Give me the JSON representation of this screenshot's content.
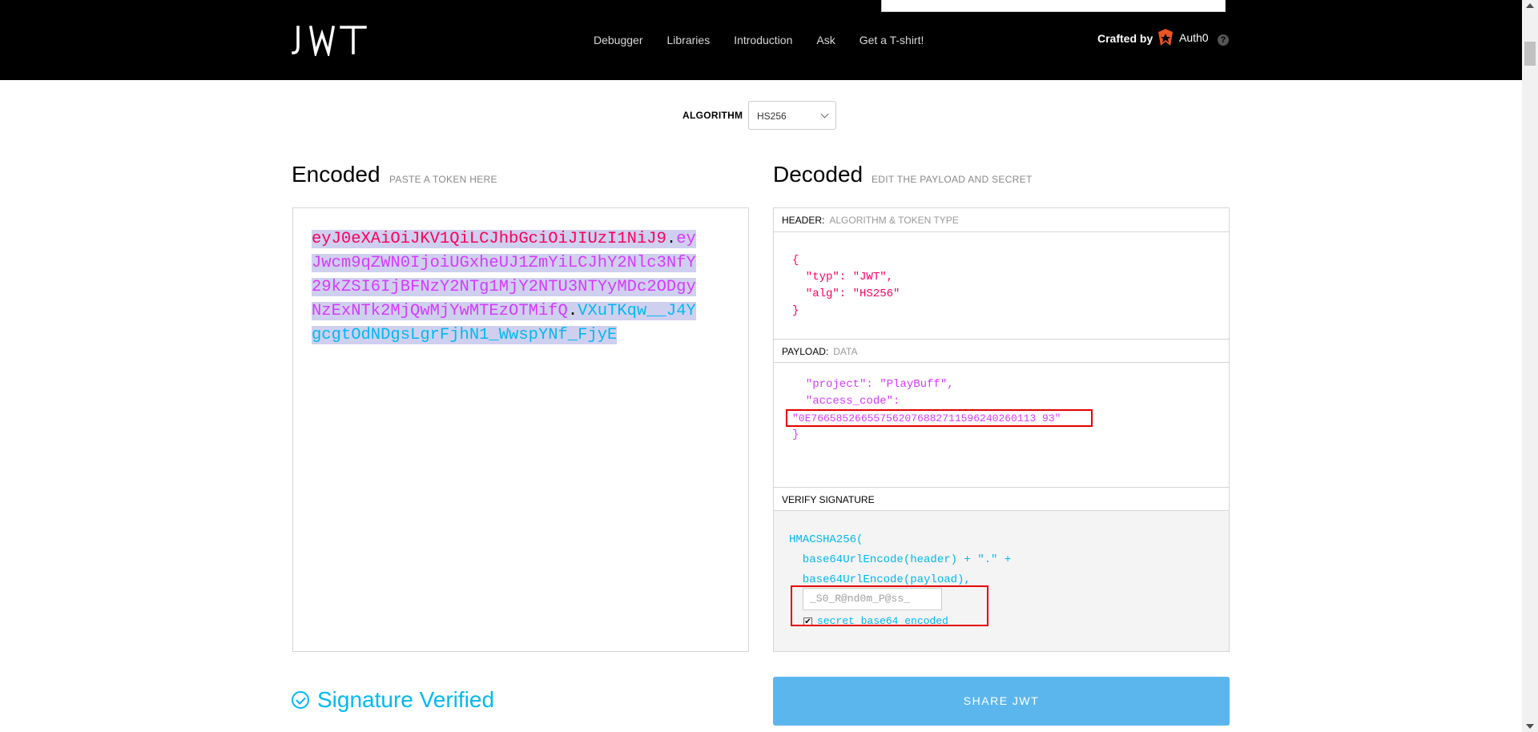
{
  "header": {
    "nav": [
      "Debugger",
      "Libraries",
      "Introduction",
      "Ask",
      "Get a T-shirt!"
    ],
    "crafted_by": "Crafted by",
    "brand": "Auth0",
    "help": "?"
  },
  "algorithm": {
    "label": "ALGORITHM",
    "value": "HS256"
  },
  "encoded": {
    "title": "Encoded",
    "subtitle": "PASTE A TOKEN HERE",
    "token_header": "eyJ0eXAiOiJKV1QiLCJhbGciOiJIUzI1NiJ9",
    "token_payload": "eyJwcm9qZWN0IjoiUGxheUJ1ZmYiLCJhY2Nlc3NfY29kZSI6IjBFNzY2NTg1MjY2NTU3NTYyMDc2ODgyNzExNTk2MjQwMjYwMTEzOTMifQ",
    "token_signature": "VXuTKqw__J4YgcgtOdNDgsLgrFjhN1_WwspYNf_FjyE",
    "dot": "."
  },
  "decoded": {
    "title": "Decoded",
    "subtitle": "EDIT THE PAYLOAD AND SECRET",
    "header_label": "HEADER:",
    "header_sub": "ALGORITHM & TOKEN TYPE",
    "header_json": "{\n  \"typ\": \"JWT\",\n  \"alg\": \"HS256\"\n}",
    "payload_label": "PAYLOAD:",
    "payload_sub": "DATA",
    "payload_line1": "  \"project\": \"PlayBuff\",",
    "payload_line2": "  \"access_code\":",
    "payload_line3": "\"0E766585266557562076882711596240260113 93\"",
    "payload_close": "}",
    "verify_label": "VERIFY SIGNATURE",
    "verify_line1": "HMACSHA256(",
    "verify_line2": "  base64UrlEncode(header) + \".\" +",
    "verify_line3": "  base64UrlEncode(payload),",
    "secret_value": "_S0_R@nd0m_P@ss_",
    "checkbox_label": "secret base64 encoded"
  },
  "status": {
    "verified": "Signature Verified"
  },
  "share_label": "SHARE JWT"
}
